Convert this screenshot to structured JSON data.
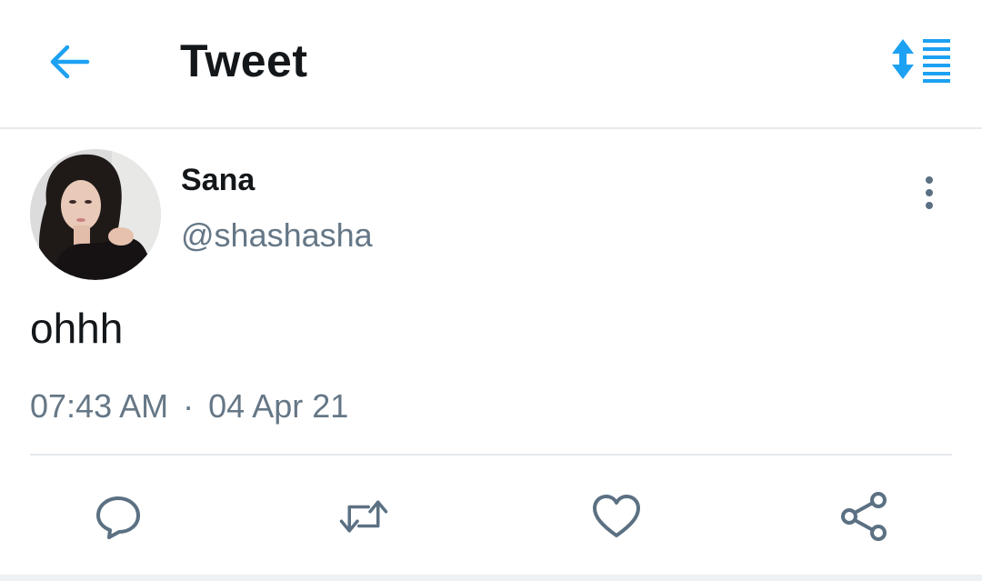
{
  "header": {
    "title": "Tweet",
    "back_icon": "arrow-left-icon",
    "sort_icon": "sort-updown-icon"
  },
  "tweet": {
    "author": {
      "name": "Sana",
      "handle": "@shashasha"
    },
    "text": "ohhh",
    "time": "07:43 AM",
    "separator": "·",
    "date": "04 Apr 21"
  },
  "actions": [
    {
      "name": "reply",
      "icon": "reply-icon"
    },
    {
      "name": "retweet",
      "icon": "retweet-icon"
    },
    {
      "name": "like",
      "icon": "heart-icon"
    },
    {
      "name": "share",
      "icon": "share-icon"
    }
  ],
  "colors": {
    "accent": "#1da1f2",
    "text": "#14171a",
    "secondary": "#657786",
    "icon": "#5b7083",
    "divider": "#e6e9eb"
  }
}
